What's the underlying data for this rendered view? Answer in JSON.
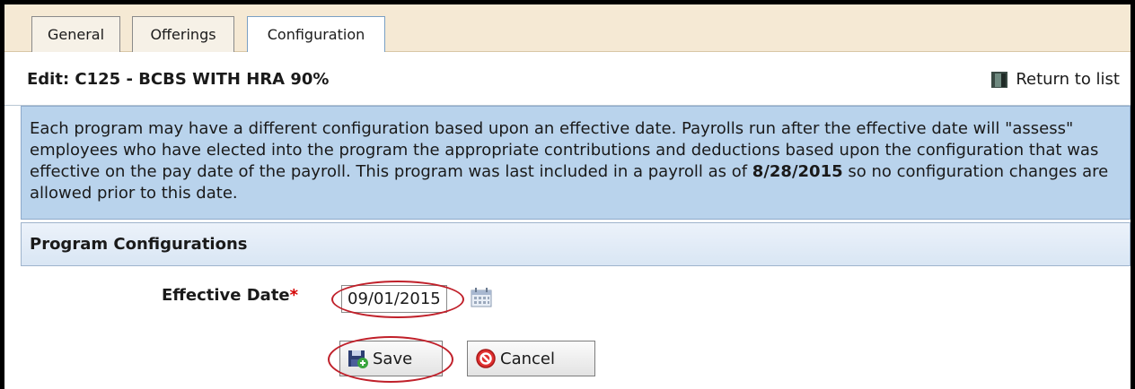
{
  "tabs": [
    {
      "label": "General",
      "active": false
    },
    {
      "label": "Offerings",
      "active": false
    },
    {
      "label": "Configuration",
      "active": true
    }
  ],
  "header": {
    "title": "Edit: C125 - BCBS WITH HRA 90%",
    "return_label": "Return to list"
  },
  "info": {
    "text_before": "Each program may have a different configuration based upon an effective date. Payrolls run after the effective date will \"assess\" employees who have elected into the program the appropriate contributions and deductions based upon the configuration that was effective on the pay date of the payroll. This program was last included in a payroll as of ",
    "last_date": "8/28/2015",
    "text_after": " so no configuration changes are allowed prior to this date."
  },
  "section": {
    "title": "Program Configurations"
  },
  "form": {
    "effective_date_label": "Effective Date",
    "required_mark": "*",
    "effective_date_value": "09/01/2015",
    "save_label": "Save",
    "cancel_label": "Cancel"
  },
  "colors": {
    "tab_bar_bg": "#f5e9d4",
    "info_bg": "#b9d3ec",
    "highlight_ring": "#c0202a",
    "required": "#d40000"
  },
  "icons": {
    "return": "door-exit-icon",
    "calendar": "calendar-icon",
    "save": "save-icon",
    "cancel": "cancel-icon"
  }
}
